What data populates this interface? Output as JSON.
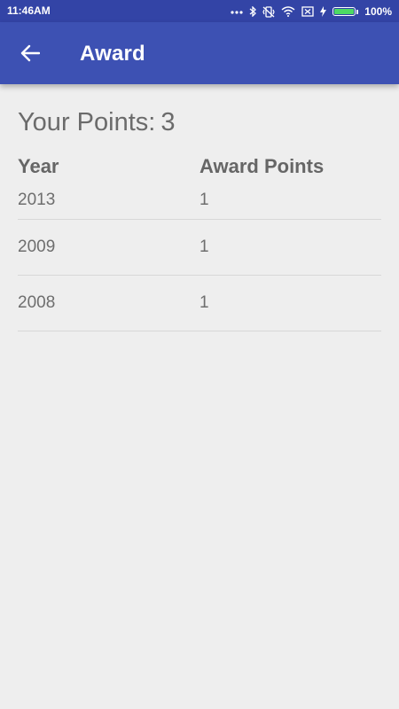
{
  "status_bar": {
    "time": "11:46AM",
    "battery_text": "100%",
    "battery_level": 1.0,
    "icons": [
      "more-dots-icon",
      "bluetooth-icon",
      "vibrate-icon",
      "wifi-icon",
      "no-sim-icon",
      "charging-icon",
      "battery-icon"
    ]
  },
  "app_bar": {
    "title": "Award",
    "back_icon": "arrow-left-icon",
    "color": "#3d51b3"
  },
  "points": {
    "label": "Your Points:",
    "value": "3"
  },
  "table": {
    "headers": {
      "year": "Year",
      "points": "Award Points"
    },
    "rows": [
      {
        "year": "2013",
        "points": "1"
      },
      {
        "year": "2009",
        "points": "1"
      },
      {
        "year": "2008",
        "points": "1"
      }
    ]
  }
}
